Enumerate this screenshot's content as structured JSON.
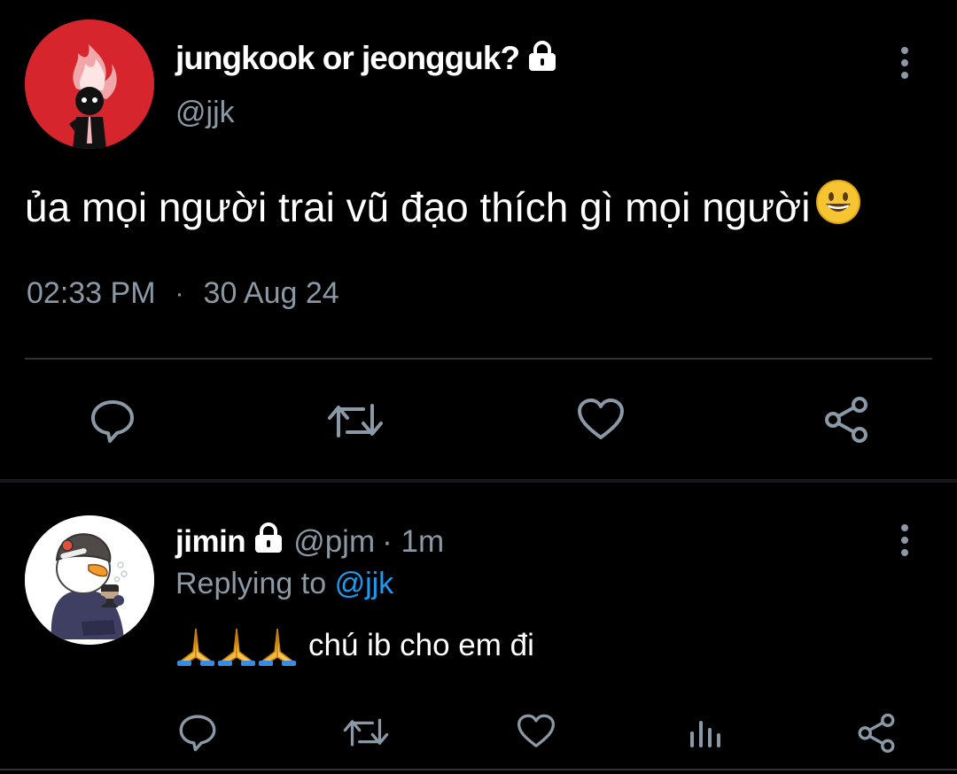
{
  "tweet": {
    "author_name": "jungkook or jeongguk?",
    "author_handle": "@jjk",
    "text": "ủa mọi người trai vũ đạo thích gì mọi người",
    "time": "02:33 PM",
    "separator": "·",
    "date": "30 Aug 24",
    "icons": {
      "protected": "lock-icon",
      "more": "kebab-menu-icon",
      "emoji": "grinning-face-emoji",
      "reply": "comment-icon",
      "retweet": "retweet-icon",
      "like": "heart-icon",
      "share": "share-icon"
    }
  },
  "reply": {
    "author_name": "jimin",
    "author_handle": "@pjm",
    "time_ago": "· 1m",
    "replying_prefix": "Replying to",
    "replying_mention": "@jjk",
    "text": "chú ib cho em đi",
    "icons": {
      "protected": "lock-icon",
      "emoji": "folded-hands-emoji",
      "reply": "comment-icon",
      "retweet": "retweet-icon",
      "like": "heart-icon",
      "analytics": "bar-chart-icon",
      "share": "share-icon"
    }
  },
  "colors": {
    "background": "#000000",
    "text_primary": "#ffffff",
    "text_secondary": "#8b98a5",
    "link": "#1d9bf0",
    "divider": "#2f3336",
    "avatar_red": "#d6252d"
  }
}
